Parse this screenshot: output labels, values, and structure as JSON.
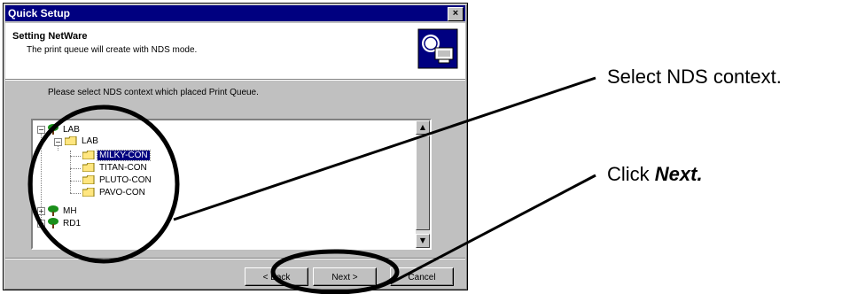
{
  "window": {
    "title": "Quick Setup",
    "close_glyph": "×"
  },
  "header": {
    "title": "Setting NetWare",
    "subtitle": "The print queue will create with NDS mode.",
    "icon": "network-printer-icon"
  },
  "instruction": "Please select NDS context which placed Print Queue.",
  "tree": {
    "nodes": {
      "lab_root": "LAB",
      "lab_child": "LAB",
      "milky": "MILKY-CON",
      "titan": "TITAN-CON",
      "pluto": "PLUTO-CON",
      "pavo": "PAVO-CON",
      "mh": "MH",
      "rd1": "RD1"
    },
    "selected": "MILKY-CON",
    "expand_open": "−",
    "expand_closed": "+"
  },
  "buttons": {
    "back": "< Back",
    "next": "Next >",
    "cancel": "Cancel"
  },
  "callouts": {
    "select": "Select NDS context.",
    "click_prefix": "Click ",
    "click_emph": "Next."
  },
  "colors": {
    "titlebar": "#000080",
    "dialog": "#c0c0c0",
    "selection": "#000080",
    "folder": "#ffe680",
    "tree_icon": "#1a8f1a"
  }
}
